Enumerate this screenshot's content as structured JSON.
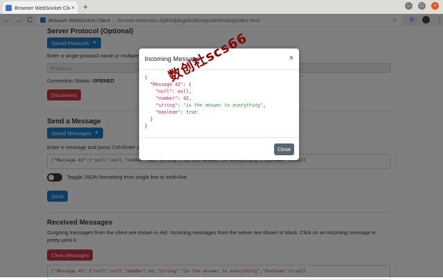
{
  "browser": {
    "tab_title": "Browser WebSocket Client",
    "tab_close": "×",
    "new_tab": "+",
    "window_controls": {
      "minimize": "–",
      "maximize": "□",
      "close": "×"
    },
    "nav": {
      "back": "←",
      "forward": "→",
      "reload": "C"
    },
    "site_name": "Browser WebSocket Client",
    "separator": "|",
    "url": "chrome-extension://pfhhlijdegbfkdkhmgnddhfirmbaj/index.html",
    "star": "☆",
    "extension_icon": "B"
  },
  "server_protocol": {
    "heading": "Server Protocol (Optional)",
    "saved_button": "Saved Protocols",
    "hint": "Enter a single protocol name or multiple comma-separated.",
    "placeholder": "Protocol",
    "status_label": "Connection Status:",
    "status_value": "OPENED",
    "disconnect_button": "Disconnect"
  },
  "send_message": {
    "heading": "Send a Message",
    "saved_button": "Saved Messages",
    "hint": "Enter a message and press Ctrl+Enter or click the Send button after connecting to a server.",
    "message_value": "{\"Message 42\":{\"null\":null,\"number\":42,\"string\":\"is the answer to everything\",\"boolean\":true}}",
    "toggle_label": "Toggle JSON formatting from single line to multi-line.",
    "send_button": "Send"
  },
  "received": {
    "heading": "Received Messages",
    "description": "Outgoing messages from the client are shown in red. Incoming messages from the server are shown in black. Click on an incoming message to pretty-print it.",
    "clear_button": "Clear Messages",
    "log_entry": "{\"Message 42\":{\"null\":null,\"number\":42,\"string\":\"is the answer to everything\",\"boolean\":true}}"
  },
  "modal": {
    "title": "Incoming Message",
    "close_x": "×",
    "close_button": "Close",
    "json": {
      "open": "{",
      "key": "\"Message 42\"",
      "null_key": "\"null\"",
      "null_val": "null",
      "number_key": "\"number\"",
      "number_val": "42",
      "string_key": "\"string\"",
      "string_val": "\"is the answer to everything\"",
      "boolean_key": "\"boolean\"",
      "boolean_val": "true",
      "inner_close": "}",
      "close": "}"
    }
  },
  "watermark": "数创社scs66",
  "colors": {
    "primary": "#1e7cc5",
    "danger": "#c9353f",
    "secondary": "#5b6570",
    "json_key": "#c7254e",
    "json_string": "#3a8c3a",
    "json_boolean": "#2a6fb5",
    "watermark": "#8b0000"
  }
}
